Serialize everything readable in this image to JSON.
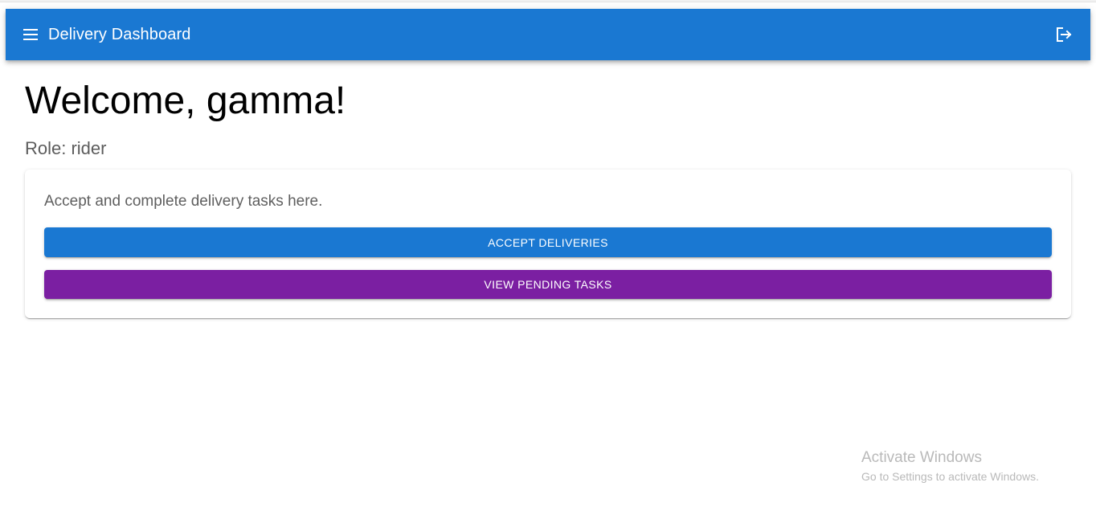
{
  "header": {
    "title": "Delivery Dashboard",
    "menu_icon": "menu-icon",
    "logout_icon": "logout-icon",
    "color": "#1a78d2"
  },
  "main": {
    "welcome": "Welcome, gamma!",
    "role": "Role: rider",
    "card": {
      "description": "Accept and complete delivery tasks here.",
      "accept_button": "ACCEPT DELIVERIES",
      "pending_button": "VIEW PENDING TASKS",
      "accept_color": "#1a78d2",
      "pending_color": "#7b1fa2"
    }
  },
  "watermark": {
    "title": "Activate Windows",
    "subtitle": "Go to Settings to activate Windows."
  }
}
